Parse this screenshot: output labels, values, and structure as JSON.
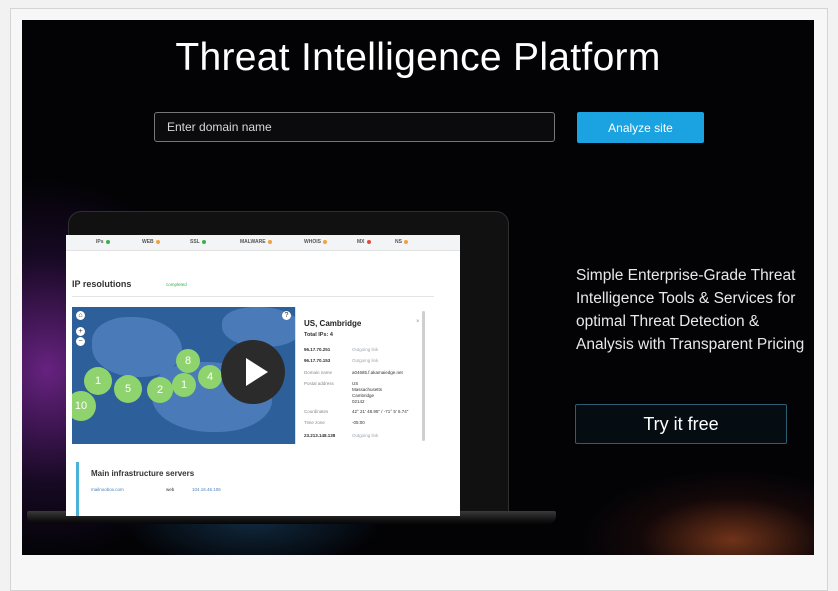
{
  "hero": {
    "title": "Threat Intelligence Platform",
    "search_placeholder": "Enter domain name",
    "analyze_label": "Analyze site",
    "tagline": "Simple Enterprise-Grade Threat Intelligence Tools & Services for optimal Threat Detection & Analysis with Transparent Pricing",
    "try_label": "Try it free"
  },
  "preview": {
    "nav_tabs": [
      {
        "label": "IPs",
        "status": "#3cb04a"
      },
      {
        "label": "WEB",
        "status": "#f2a23a"
      },
      {
        "label": "SSL",
        "status": "#3cb04a"
      },
      {
        "label": "MALWARE",
        "status": "#f2a23a"
      },
      {
        "label": "WHOIS",
        "status": "#f2a23a"
      },
      {
        "label": "MX",
        "status": "#e24a3b"
      },
      {
        "label": "NS",
        "status": "#f2a23a"
      }
    ],
    "section_title": "IP resolutions",
    "section_status": "completed",
    "map_bubbles": [
      "8",
      "1",
      "5",
      "2",
      "1",
      "4",
      "10"
    ],
    "panel": {
      "city": "US, Cambridge",
      "total": "Total IPs: 4",
      "ip1": "96.17.70.251",
      "ip2": "96.17.70.153",
      "outgoing": "Outgoing link",
      "k_domain": "Domain name",
      "v_domain": "a04685.f.akamaiedge.net",
      "k_postal": "Postal address",
      "v_postal_1": "US",
      "v_postal_2": "Massachusetts",
      "v_postal_3": "Cambridge",
      "v_postal_4": "02142",
      "k_coord": "Coordinates",
      "v_coord": "42° 21' 48.95\" / -71° 5' 6.74\"",
      "k_tz": "Time zone",
      "v_tz": "-05:00",
      "ip3": "23.213.148.138"
    },
    "infra": {
      "title": "Main infrastructure servers",
      "host": "mailnoobox.com",
      "type": "web",
      "ip": "104.16.46.106"
    }
  },
  "colors": {
    "accent": "#1aa3e0",
    "bubble": "#8fd36e"
  }
}
